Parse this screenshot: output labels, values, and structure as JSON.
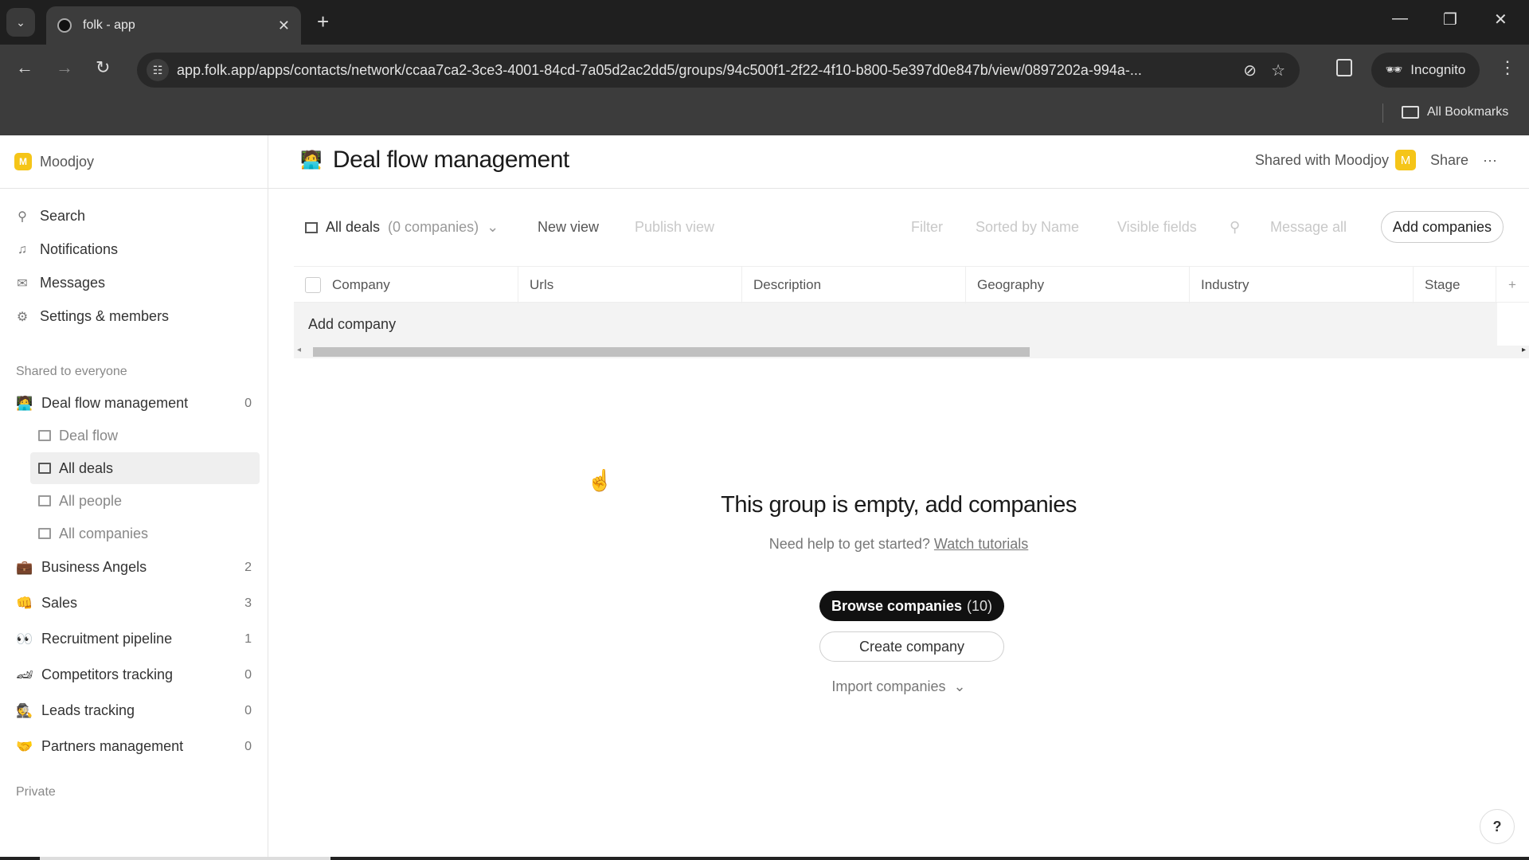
{
  "browser": {
    "tab_title": "folk - app",
    "url": "app.folk.app/apps/contacts/network/ccaa7ca2-3ce3-4001-84cd-7a05d2ac2dd5/groups/94c500f1-2f22-4f10-b800-5e397d0e847b/view/0897202a-994a-...",
    "incognito_label": "Incognito",
    "bookmarks_label": "All Bookmarks"
  },
  "sidebar": {
    "workspace": {
      "badge": "M",
      "name": "Moodjoy"
    },
    "nav": [
      {
        "icon": "search-icon",
        "glyph": "⚲",
        "label": "Search"
      },
      {
        "icon": "bell-icon",
        "glyph": "🔔︎",
        "label": "Notifications"
      },
      {
        "icon": "mail-icon",
        "glyph": "✉",
        "label": "Messages"
      },
      {
        "icon": "gear-icon",
        "glyph": "⚙",
        "label": "Settings & members"
      }
    ],
    "shared_label": "Shared to everyone",
    "groups": [
      {
        "emoji": "🧑‍💻",
        "name": "Deal flow management",
        "count": "0"
      },
      {
        "emoji": "💼",
        "name": "Business Angels",
        "count": "2"
      },
      {
        "emoji": "👊",
        "name": "Sales",
        "count": "3"
      },
      {
        "emoji": "👀",
        "name": "Recruitment pipeline",
        "count": "1"
      },
      {
        "emoji": "🏎",
        "name": "Competitors tracking",
        "count": "0"
      },
      {
        "emoji": "🕵",
        "name": "Leads tracking",
        "count": "0"
      },
      {
        "emoji": "🤝",
        "name": "Partners management",
        "count": "0"
      }
    ],
    "views": [
      {
        "label": "Deal flow",
        "active": false
      },
      {
        "label": "All deals",
        "active": true
      },
      {
        "label": "All people",
        "active": false
      },
      {
        "label": "All companies",
        "active": false
      }
    ],
    "private_label": "Private"
  },
  "header": {
    "emoji": "🧑‍💻",
    "title": "Deal flow management",
    "shared_with": "Shared with Moodjoy",
    "shared_badge": "M",
    "share_label": "Share",
    "more_label": "···"
  },
  "viewbar": {
    "view_name": "All deals",
    "view_count": "(0 companies)",
    "new_view": "New view",
    "publish_view": "Publish view",
    "filter": "Filter",
    "sort": "Sorted by Name",
    "visible_fields": "Visible fields",
    "message_all": "Message all",
    "add_companies": "Add companies"
  },
  "table": {
    "columns": [
      "Company",
      "Urls",
      "Description",
      "Geography",
      "Industry",
      "Stage"
    ],
    "add_row_label": "Add company"
  },
  "empty_state": {
    "title": "This group is empty, add companies",
    "subtitle": "Need help to get started?",
    "link": "Watch tutorials",
    "browse_label": "Browse companies",
    "browse_count": "(10)",
    "create_label": "Create company",
    "import_label": "Import companies"
  },
  "help_label": "?"
}
